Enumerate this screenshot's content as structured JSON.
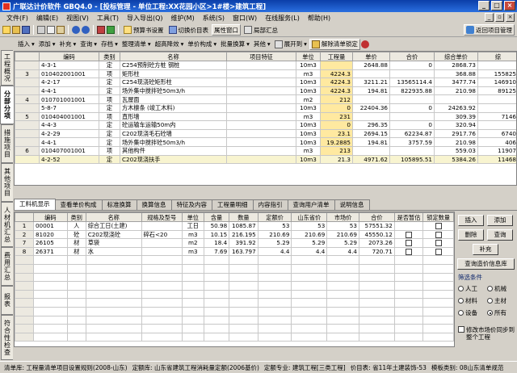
{
  "title": "广联达计价软件 GBQ4.0 - [投标管理 - 单位工程:XX花园小区>1#楼>建筑工程]",
  "menu": [
    "文件(F)",
    "编辑(E)",
    "视图(V)",
    "工具(T)",
    "导入导出(Q)",
    "维护(M)",
    "系统(S)",
    "窗口(W)",
    "在线服务(L)",
    "帮助(H)"
  ],
  "toolbar1": {
    "buttons": [
      "预算书设置",
      "切换价目表",
      "属性窗口",
      "局部汇总"
    ],
    "right": "返回项目管理"
  },
  "toolbar2": [
    "插入",
    "添加",
    "补充",
    "查询",
    "存档",
    "整理清单",
    "超高降效",
    "单价构成",
    "批量换算",
    "其他",
    "展开到",
    "解除清单锁定"
  ],
  "left_tabs": [
    "工程概况",
    "分部分项",
    "措施项目",
    "其他项目",
    "人材机汇总",
    "费用汇总",
    "报表",
    "符合性检查"
  ],
  "main_table": {
    "headers": [
      "",
      "编码",
      "类别",
      "名称",
      "项目特征",
      "单位",
      "工程量",
      "单价",
      "合价",
      "综合单价",
      "综"
    ],
    "rows": [
      {
        "rownum": "",
        "code": "4-3-1",
        "type": "定",
        "name": "C254预制砼方桩 钢桩",
        "feature": "",
        "unit": "10m3",
        "qty": "",
        "price": "2648.88",
        "total": "0",
        "unit_price": "2868.73",
        "tot2": ""
      },
      {
        "rownum": "3",
        "code": "010402001001",
        "type": "项",
        "name": "矩形柱",
        "feature": "",
        "unit": "m3",
        "qty": "4224.3",
        "price": "",
        "total": "",
        "unit_price": "368.88",
        "tot2": "155825"
      },
      {
        "rownum": "",
        "code": "4-2-17",
        "type": "定",
        "name": "C254现浇砼矩形柱",
        "feature": "",
        "unit": "10m3",
        "qty": "4224.3",
        "price": "3211.21",
        "total": "13565114.4",
        "unit_price": "3477.74",
        "tot2": "146910"
      },
      {
        "rownum": "",
        "code": "4-4-1",
        "type": "定",
        "name": "场外集中搅拌砼50m3/h",
        "feature": "",
        "unit": "10m3",
        "qty": "4224.3",
        "price": "194.81",
        "total": "822935.88",
        "unit_price": "210.98",
        "tot2": "89125"
      },
      {
        "rownum": "4",
        "code": "010701001001",
        "type": "项",
        "name": "瓦屋面",
        "feature": "",
        "unit": "m2",
        "qty": "212",
        "price": "",
        "total": "",
        "unit_price": "",
        "tot2": ""
      },
      {
        "rownum": "",
        "code": "5-8-7",
        "type": "定",
        "name": "方木檩条 (竣工木料)",
        "feature": "",
        "unit": "10m3",
        "qty": "0",
        "price": "22404.36",
        "total": "0",
        "unit_price": "24263.92",
        "tot2": ""
      },
      {
        "rownum": "5",
        "code": "010404001001",
        "type": "项",
        "name": "直形墙",
        "feature": "",
        "unit": "m3",
        "qty": "231",
        "price": "",
        "total": "",
        "unit_price": "309.39",
        "tot2": "7146"
      },
      {
        "rownum": "",
        "code": "4-4-3",
        "type": "定",
        "name": "砼运输车运输50m内",
        "feature": "",
        "unit": "10m3",
        "qty": "0",
        "price": "296.35",
        "total": "0",
        "unit_price": "320.94",
        "tot2": ""
      },
      {
        "rownum": "",
        "code": "4-2-29",
        "type": "定",
        "name": "C202现浇毛石砼墙",
        "feature": "",
        "unit": "10m3",
        "qty": "23.1",
        "price": "2694.15",
        "total": "62234.87",
        "unit_price": "2917.76",
        "tot2": "6740"
      },
      {
        "rownum": "",
        "code": "4-4-1",
        "type": "定",
        "name": "场外集中搅拌砼50m3/h",
        "feature": "",
        "unit": "10m3",
        "qty": "19.2885",
        "price": "194.81",
        "total": "3757.59",
        "unit_price": "210.98",
        "tot2": "406"
      },
      {
        "rownum": "6",
        "code": "010407001001",
        "type": "项",
        "name": "其他构件",
        "feature": "",
        "unit": "m3",
        "qty": "213",
        "price": "",
        "total": "",
        "unit_price": "559.03",
        "tot2": "11907"
      },
      {
        "rownum": "",
        "code": "4-2-52",
        "type": "定",
        "name": "C202现浇扶手",
        "feature": "",
        "unit": "10m3",
        "qty": "21.3",
        "price": "4971.62",
        "total": "105895.51",
        "unit_price": "5384.26",
        "tot2": "11468"
      }
    ]
  },
  "bottom_tabs": [
    "工料机显示",
    "查看单价构成",
    "标准换算",
    "换算信息",
    "特征及内容",
    "工程量明细",
    "内容指引",
    "查询用户清单",
    "说明信息"
  ],
  "bottom_table": {
    "headers": [
      "",
      "编码",
      "类别",
      "名称",
      "规格及型号",
      "单位",
      "含量",
      "数量",
      "定额价",
      "山东省价",
      "市场价",
      "合价",
      "是否暂估",
      "锁定数量"
    ],
    "rows": [
      {
        "idx": "1",
        "code": "00001",
        "type": "人",
        "name": "综合工日(土建)",
        "spec": "",
        "unit": "工日",
        "content": "50.98",
        "qty": "1085.87",
        "quota": "53",
        "sd": "53",
        "market": "53",
        "total": "57551.32"
      },
      {
        "idx": "2",
        "code": "81020",
        "type": "砼",
        "name": "C202现浇砼",
        "spec": "碎石<20",
        "unit": "m3",
        "content": "10.15",
        "qty": "216.195",
        "quota": "210.69",
        "sd": "210.69",
        "market": "210.69",
        "total": "45550.12"
      },
      {
        "idx": "7",
        "code": "26105",
        "type": "材",
        "name": "草袋",
        "spec": "",
        "unit": "m2",
        "content": "18.4",
        "qty": "391.92",
        "quota": "5.29",
        "sd": "5.29",
        "market": "5.29",
        "total": "2073.26"
      },
      {
        "idx": "8",
        "code": "26371",
        "type": "材",
        "name": "水",
        "spec": "",
        "unit": "m3",
        "content": "7.69",
        "qty": "163.797",
        "quota": "4.4",
        "sd": "4.4",
        "market": "4.4",
        "total": "720.71"
      }
    ]
  },
  "right_panel": {
    "buttons": [
      "插入",
      "添加",
      "删除",
      "查询",
      "补充",
      "查询造价信息库"
    ],
    "filter_label": "筛选条件",
    "filters": [
      "人工",
      "机械",
      "材料",
      "主材",
      "设备",
      "所有"
    ],
    "sync_label": "修改市场价同步到整个工程"
  },
  "status": [
    "清单库: 工程量清单项目设置规则(2008-山东)",
    "定额库: 山东省建筑工程消耗量定额(2006基价)",
    "定额专业: 建筑工程[三类工程]",
    "价目表: 省11年土建装饰-53",
    "模板类别: 08山东清单规范"
  ]
}
